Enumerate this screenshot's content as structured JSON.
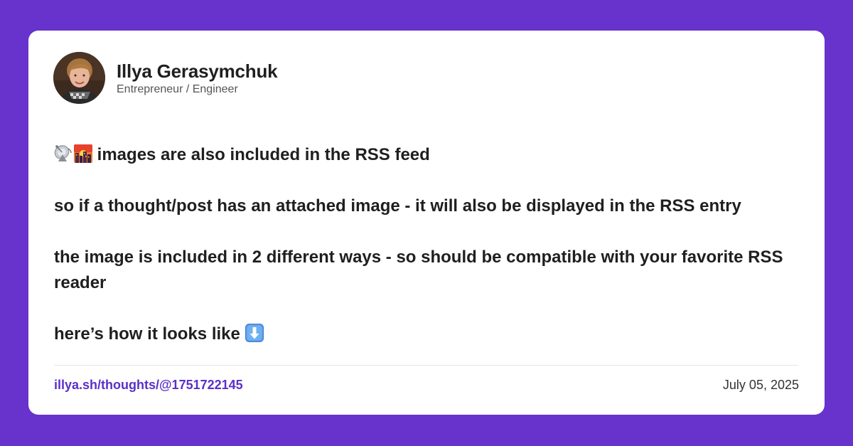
{
  "colors": {
    "background": "#6733cc",
    "card": "#ffffff",
    "link": "#5b2fc9",
    "text": "#1f1f1f"
  },
  "author": {
    "name": "Illya Gerasymchuk",
    "role": "Entrepreneur / Engineer"
  },
  "post": {
    "paragraphs": [
      {
        "icons": [
          "satellite-antenna-icon",
          "city-sunset-icon"
        ],
        "text": "images are also included in the RSS feed"
      },
      {
        "text": "so if a thought/post has an attached image - it will also be displayed in the RSS entry"
      },
      {
        "text": "the image is included in 2 different ways - so should be compatible with your favorite RSS reader"
      },
      {
        "text": "here’s how it looks like",
        "trailing_icon": "down-arrow-icon"
      }
    ]
  },
  "footer": {
    "link": "illya.sh/thoughts/@1751722145",
    "date": "July 05, 2025"
  }
}
